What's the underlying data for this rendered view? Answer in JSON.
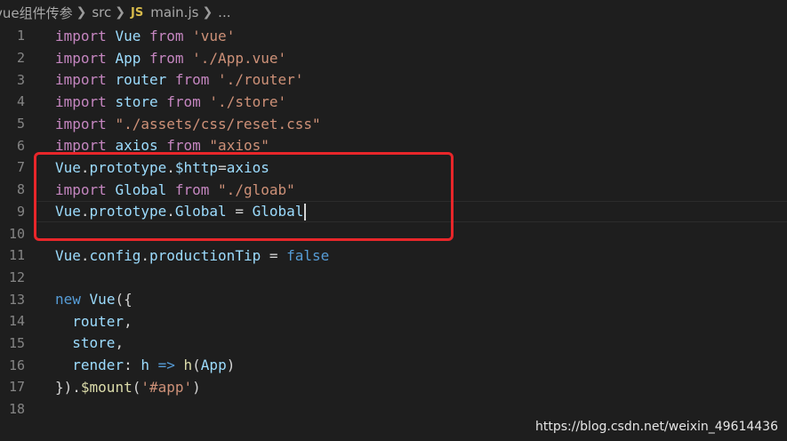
{
  "breadcrumb": {
    "items": [
      "vue组件传参",
      "src",
      "main.js",
      "..."
    ],
    "file_icon": "JS"
  },
  "editor": {
    "lines": [
      {
        "num": "1",
        "tokens": [
          {
            "t": "import",
            "c": "kw"
          },
          {
            "t": " "
          },
          {
            "t": "Vue",
            "c": "var"
          },
          {
            "t": " "
          },
          {
            "t": "from",
            "c": "kw"
          },
          {
            "t": " "
          },
          {
            "t": "'vue'",
            "c": "str"
          }
        ]
      },
      {
        "num": "2",
        "tokens": [
          {
            "t": "import",
            "c": "kw"
          },
          {
            "t": " "
          },
          {
            "t": "App",
            "c": "var"
          },
          {
            "t": " "
          },
          {
            "t": "from",
            "c": "kw"
          },
          {
            "t": " "
          },
          {
            "t": "'./App.vue'",
            "c": "str"
          }
        ]
      },
      {
        "num": "3",
        "tokens": [
          {
            "t": "import",
            "c": "kw"
          },
          {
            "t": " "
          },
          {
            "t": "router",
            "c": "var"
          },
          {
            "t": " "
          },
          {
            "t": "from",
            "c": "kw"
          },
          {
            "t": " "
          },
          {
            "t": "'./router'",
            "c": "str"
          }
        ]
      },
      {
        "num": "4",
        "tokens": [
          {
            "t": "import",
            "c": "kw"
          },
          {
            "t": " "
          },
          {
            "t": "store",
            "c": "var"
          },
          {
            "t": " "
          },
          {
            "t": "from",
            "c": "kw"
          },
          {
            "t": " "
          },
          {
            "t": "'./store'",
            "c": "str"
          }
        ]
      },
      {
        "num": "5",
        "tokens": [
          {
            "t": "import",
            "c": "kw"
          },
          {
            "t": " "
          },
          {
            "t": "\"./assets/css/reset.css\"",
            "c": "str"
          }
        ]
      },
      {
        "num": "6",
        "tokens": [
          {
            "t": "import",
            "c": "kw"
          },
          {
            "t": " "
          },
          {
            "t": "axios",
            "c": "var"
          },
          {
            "t": " "
          },
          {
            "t": "from",
            "c": "kw"
          },
          {
            "t": " "
          },
          {
            "t": "\"axios\"",
            "c": "str"
          }
        ]
      },
      {
        "num": "7",
        "tokens": [
          {
            "t": "Vue",
            "c": "var"
          },
          {
            "t": "."
          },
          {
            "t": "prototype",
            "c": "var"
          },
          {
            "t": "."
          },
          {
            "t": "$http",
            "c": "var"
          },
          {
            "t": "="
          },
          {
            "t": "axios",
            "c": "var"
          }
        ]
      },
      {
        "num": "8",
        "tokens": [
          {
            "t": "import",
            "c": "kw"
          },
          {
            "t": " "
          },
          {
            "t": "Global",
            "c": "var"
          },
          {
            "t": " "
          },
          {
            "t": "from",
            "c": "kw"
          },
          {
            "t": " "
          },
          {
            "t": "\"./gloab\"",
            "c": "str"
          }
        ]
      },
      {
        "num": "9",
        "tokens": [
          {
            "t": "Vue",
            "c": "var"
          },
          {
            "t": "."
          },
          {
            "t": "prototype",
            "c": "var"
          },
          {
            "t": "."
          },
          {
            "t": "Global",
            "c": "var"
          },
          {
            "t": " = "
          },
          {
            "t": "Global",
            "c": "var"
          }
        ],
        "cursor": true
      },
      {
        "num": "10",
        "tokens": []
      },
      {
        "num": "11",
        "tokens": [
          {
            "t": "Vue",
            "c": "var"
          },
          {
            "t": "."
          },
          {
            "t": "config",
            "c": "var"
          },
          {
            "t": "."
          },
          {
            "t": "productionTip",
            "c": "var"
          },
          {
            "t": " = "
          },
          {
            "t": "false",
            "c": "blue"
          }
        ]
      },
      {
        "num": "12",
        "tokens": []
      },
      {
        "num": "13",
        "tokens": [
          {
            "t": "new",
            "c": "blue"
          },
          {
            "t": " "
          },
          {
            "t": "Vue",
            "c": "var"
          },
          {
            "t": "({"
          }
        ]
      },
      {
        "num": "14",
        "tokens": [
          {
            "t": "  "
          },
          {
            "t": "router",
            "c": "var"
          },
          {
            "t": ","
          }
        ]
      },
      {
        "num": "15",
        "tokens": [
          {
            "t": "  "
          },
          {
            "t": "store",
            "c": "var"
          },
          {
            "t": ","
          }
        ]
      },
      {
        "num": "16",
        "tokens": [
          {
            "t": "  "
          },
          {
            "t": "render",
            "c": "var"
          },
          {
            "t": ": "
          },
          {
            "t": "h",
            "c": "var"
          },
          {
            "t": " "
          },
          {
            "t": "=>",
            "c": "blue"
          },
          {
            "t": " "
          },
          {
            "t": "h",
            "c": "fn"
          },
          {
            "t": "("
          },
          {
            "t": "App",
            "c": "var"
          },
          {
            "t": ")"
          }
        ]
      },
      {
        "num": "17",
        "tokens": [
          {
            "t": "})."
          },
          {
            "t": "$mount",
            "c": "fn"
          },
          {
            "t": "("
          },
          {
            "t": "'#app'",
            "c": "str"
          },
          {
            "t": ")"
          }
        ]
      },
      {
        "num": "18",
        "tokens": []
      }
    ]
  },
  "watermark": "https://blog.csdn.net/weixin_49614436",
  "colors": {
    "background": "#1e1e1e",
    "keyword": "#c586c0",
    "variable": "#9cdcfe",
    "string": "#ce9178",
    "highlight_box": "#e8262a"
  }
}
